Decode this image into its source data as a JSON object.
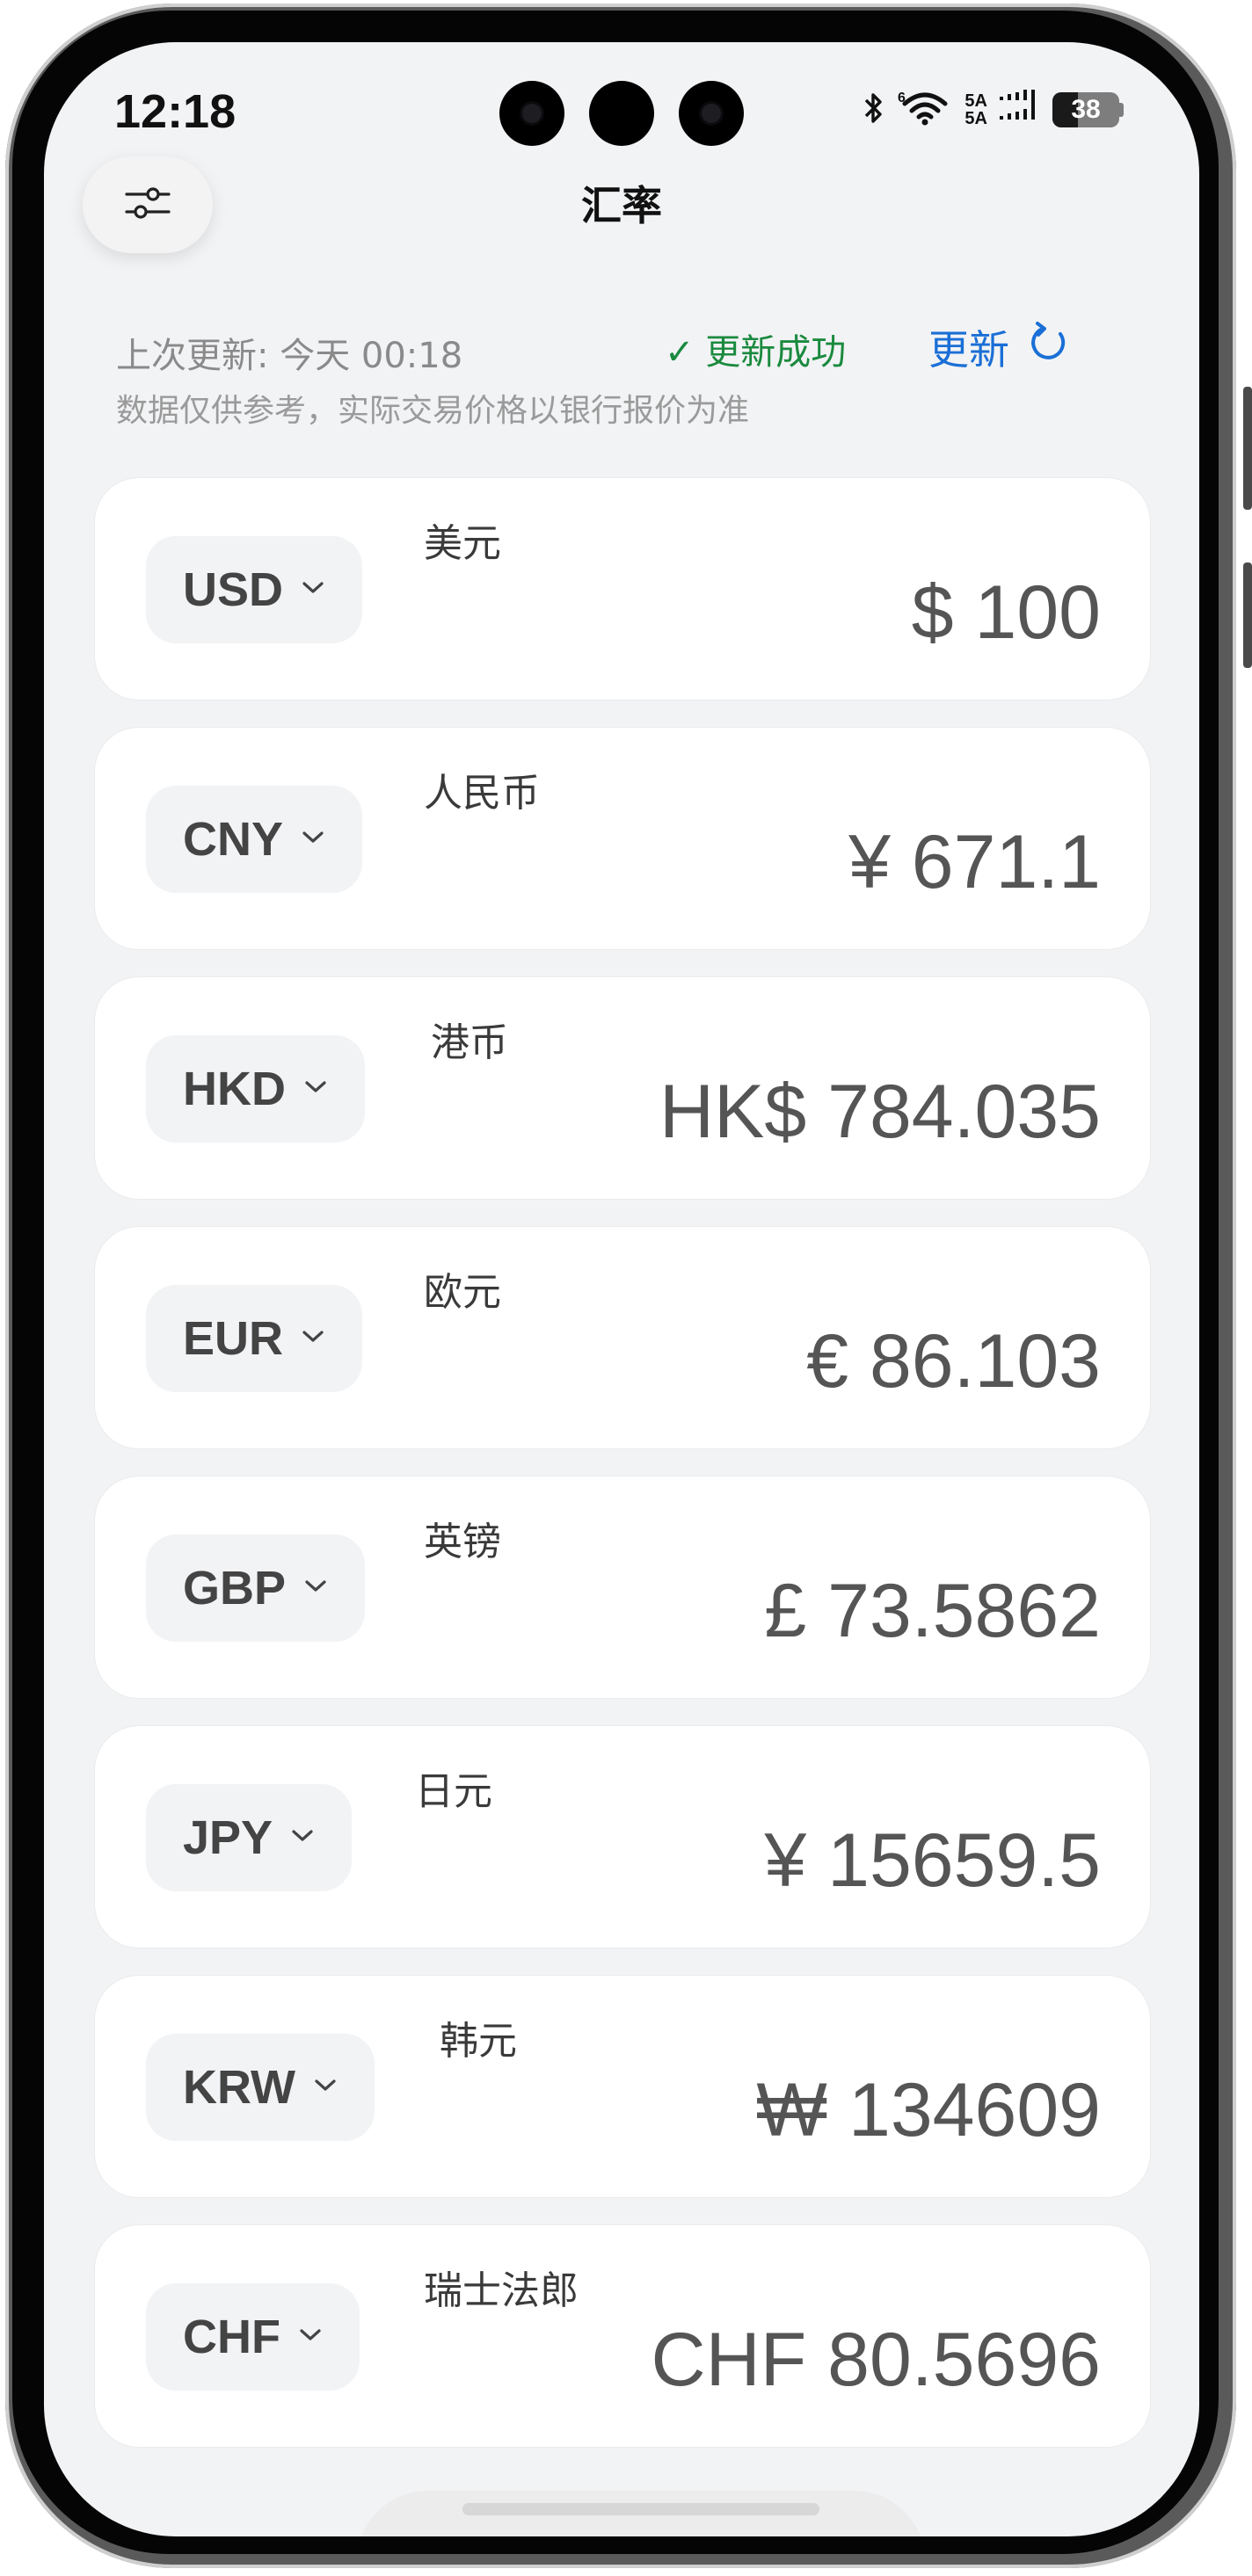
{
  "status_bar": {
    "time": "12:18",
    "bluetooth_icon": "bluetooth-icon",
    "wifi_label": "6",
    "signal_top": "5A",
    "signal_bottom": "5A",
    "battery": "38",
    "battery_level": 0.38
  },
  "header": {
    "title": "汇率",
    "settings_icon": "sliders-icon"
  },
  "update": {
    "last_update": "上次更新: 今天 00:18",
    "success": "✓ 更新成功",
    "refresh_label": "更新",
    "refresh_icon": "refresh-icon",
    "disclaimer": "数据仅供参考，实际交易价格以银行报价为准"
  },
  "colors": {
    "success": "#1a8a3e",
    "link": "#1a6fd6",
    "background": "#f2f3f5"
  },
  "currencies": [
    {
      "code": "USD",
      "name": "美元",
      "amount": "$ 100"
    },
    {
      "code": "CNY",
      "name": "人民币",
      "amount": "¥ 671.1"
    },
    {
      "code": "HKD",
      "name": "港币",
      "amount": "HK$ 784.035"
    },
    {
      "code": "EUR",
      "name": "欧元",
      "amount": "€ 86.103"
    },
    {
      "code": "GBP",
      "name": "英镑",
      "amount": "£ 73.5862"
    },
    {
      "code": "JPY",
      "name": "日元",
      "amount": "¥ 15659.5"
    },
    {
      "code": "KRW",
      "name": "韩元",
      "amount": "₩ 134609"
    },
    {
      "code": "CHF",
      "name": "瑞士法郎",
      "amount": "CHF 80.5696"
    }
  ]
}
